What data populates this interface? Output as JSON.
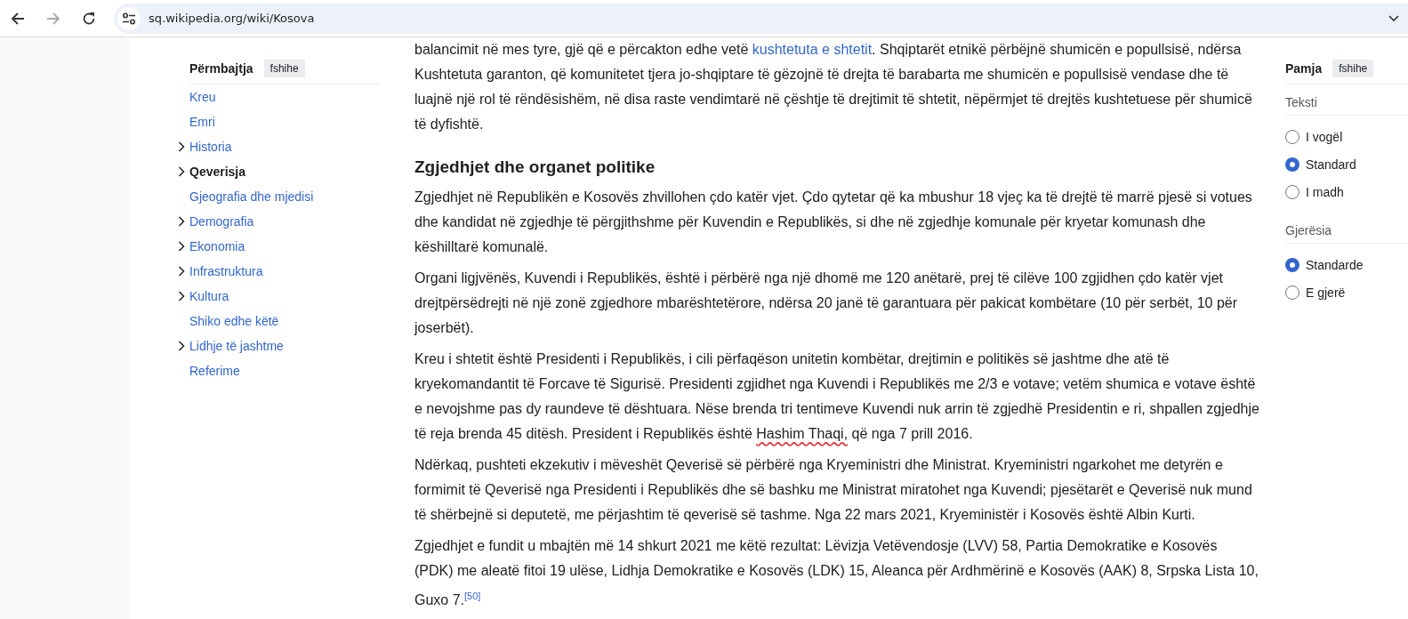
{
  "browser": {
    "nav_buttons": [
      {
        "kind": "back",
        "disabled": false
      },
      {
        "kind": "forward",
        "disabled": true
      },
      {
        "kind": "reload",
        "disabled": false
      }
    ],
    "url": "sq.wikipedia.org/wiki/Kosova"
  },
  "toc": {
    "title": "Përmbajtja",
    "hide_label": "fshihe",
    "items": [
      {
        "label": "Kreu",
        "expandable": false,
        "selected": false
      },
      {
        "label": "Emri",
        "expandable": false,
        "selected": false
      },
      {
        "label": "Historia",
        "expandable": true,
        "selected": false
      },
      {
        "label": "Qeverisja",
        "expandable": true,
        "selected": true
      },
      {
        "label": "Gjeografia dhe mjedisi",
        "expandable": false,
        "selected": false
      },
      {
        "label": "Demografia",
        "expandable": true,
        "selected": false
      },
      {
        "label": "Ekonomia",
        "expandable": true,
        "selected": false
      },
      {
        "label": "Infrastruktura",
        "expandable": true,
        "selected": false
      },
      {
        "label": "Kultura",
        "expandable": true,
        "selected": false
      },
      {
        "label": "Shiko edhe këtë",
        "expandable": false,
        "selected": false
      },
      {
        "label": "Lidhje të jashtme",
        "expandable": true,
        "selected": false
      },
      {
        "label": "Referime",
        "expandable": false,
        "selected": false
      }
    ]
  },
  "article": [
    {
      "kind": "paragraph",
      "segments": [
        {
          "kind": "text",
          "text": "balancimit në mes tyre, gjë që e përcakton edhe vetë "
        },
        {
          "kind": "link",
          "text": "kushtetuta e shtetit"
        },
        {
          "kind": "text",
          "text": ". Shqiptarët etnikë përbëjnë shumicën e popullsisë, ndërsa Kushtetuta garanton, që komunitetet tjera jo-shqiptare të gëzojnë të drejta të barabarta me shumicën e popullsisë vendase dhe të luajnë një rol të rëndësishëm, në disa raste vendimtarë në çështje të drejtimit të shtetit, nëpërmjet të drejtës kushtetuese për shumicë të dyfishtë."
        }
      ]
    },
    {
      "kind": "heading",
      "text": "Zgjedhjet dhe organet politike"
    },
    {
      "kind": "paragraph",
      "segments": [
        {
          "kind": "text",
          "text": "Zgjedhjet në Republikën e Kosovës zhvillohen çdo katër vjet. Çdo qytetar që ka mbushur 18 vjeç ka të drejtë të marrë pjesë si votues dhe kandidat në zgjedhje të përgjithshme për Kuvendin e Republikës, si dhe në zgjedhje komunale për kryetar komunash dhe këshilltarë komunalë."
        }
      ]
    },
    {
      "kind": "paragraph",
      "segments": [
        {
          "kind": "text",
          "text": "Organi ligjvënës, Kuvendi i Republikës, është i përbërë nga një dhomë me 120 anëtarë, prej të cilëve 100 zgjidhen çdo katër vjet drejtpërsëdrejti në një zonë zgjedhore mbarështetërore, ndërsa 20 janë të garantuara për pakicat kombëtare (10 për serbët, 10 për joserbët)."
        }
      ]
    },
    {
      "kind": "paragraph",
      "segments": [
        {
          "kind": "text",
          "text": "Kreu i shtetit është Presidenti i Republikës, i cili përfaqëson unitetin kombëtar, drejtimin e politikës së jashtme dhe atë të kryekomandantit të Forcave të Sigurisë. Presidenti zgjidhet nga Kuvendi i Republikës me 2/3 e votave; vetëm shumica e votave është e nevojshme pas dy raundeve të dështuara. Nëse brenda tri tentimeve Kuvendi nuk arrin të zgjedhë Presidentin e ri, shpallen zgjedhje të reja brenda 45 ditësh. President i Republikës është "
        },
        {
          "kind": "misspelled",
          "text": "Hashim Thaqi,"
        },
        {
          "kind": "text",
          "text": " që nga 7 prill 2016."
        }
      ]
    },
    {
      "kind": "paragraph",
      "segments": [
        {
          "kind": "text",
          "text": "Ndërkaq, pushteti ekzekutiv i mëveshët Qeverisë së përbërë nga Kryeministri dhe Ministrat. Kryeministri ngarkohet me detyrën e formimit të Qeverisë nga Presidenti i Republikës dhe së bashku me Ministrat miratohet nga Kuvendi; pjesëtarët e Qeverisë nuk mund të shërbejnë si deputetë, me përjashtim të qeverisë së tashme. Nga 22 mars 2021, Kryeministër i Kosovës është Albin Kurti."
        }
      ]
    },
    {
      "kind": "paragraph",
      "segments": [
        {
          "kind": "text",
          "text": "Zgjedhjet e fundit u mbajtën më 14 shkurt 2021 me këtë rezultat: Lëvizja Vetëvendosje (LVV) 58, Partia Demokratike e Kosovës (PDK) me aleatë fitoi 19 ulëse, Lidhja Demokratike e Kosovës (LDK) 15, Aleanca për Ardhmërinë e Kosovës (AAK) 8, Srpska Lista 10, Guxo 7."
        },
        {
          "kind": "footnote",
          "text": "[50]"
        }
      ]
    }
  ],
  "appearance": {
    "title": "Pamja",
    "hide_label": "fshihe",
    "groups": [
      {
        "title": "Teksti",
        "options": [
          {
            "label": "I vogël",
            "selected": false
          },
          {
            "label": "Standard",
            "selected": true
          },
          {
            "label": "I madh",
            "selected": false
          }
        ]
      },
      {
        "title": "Gjerësia",
        "options": [
          {
            "label": "Standarde",
            "selected": true
          },
          {
            "label": "E gjerë",
            "selected": false
          }
        ]
      }
    ]
  }
}
